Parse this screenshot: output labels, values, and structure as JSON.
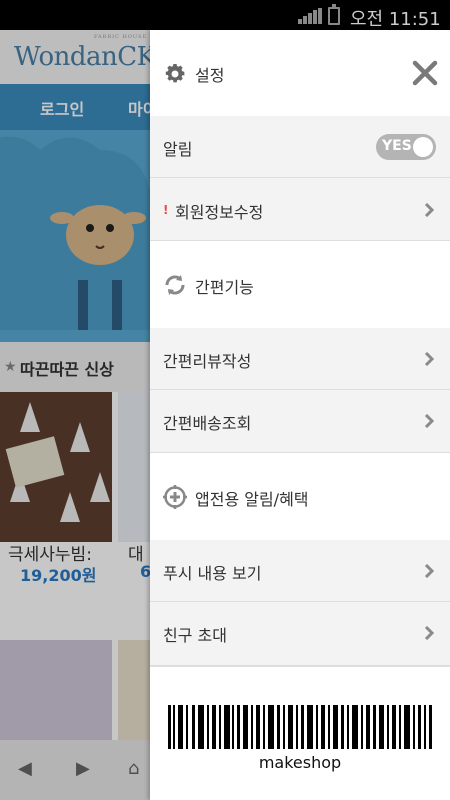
{
  "status_bar": {
    "time": "오전 11:51",
    "signal_icon": "signal-icon",
    "battery_icon": "battery-icon"
  },
  "background_app": {
    "logo": "WondanCK",
    "logo_tagline": "FABRIC HOUSE",
    "nav": [
      "로그인",
      "마이"
    ],
    "section_title": "따끈따끈 신상",
    "products": [
      {
        "name": "극세사누빔:",
        "price": "19,200원"
      },
      {
        "name": "대",
        "price": "6"
      }
    ],
    "bottom_nav": [
      "back-icon",
      "forward-icon",
      "home-icon"
    ]
  },
  "drawer": {
    "header": {
      "icon": "gear-icon",
      "title": "설정",
      "close_icon": "close-icon"
    },
    "notification": {
      "label": "알림",
      "toggle_text": "YES",
      "on": true
    },
    "member_edit": {
      "marker": "!",
      "label": "회원정보수정"
    },
    "quick_section": {
      "icon": "refresh-icon",
      "title": "간편기능",
      "items": [
        {
          "label": "간편리뷰작성"
        },
        {
          "label": "간편배송조회"
        }
      ]
    },
    "app_section": {
      "icon": "crosshair-plus-icon",
      "title": "앱전용 알림/혜택",
      "items": [
        {
          "label": "푸시 내용 보기"
        },
        {
          "label": "친구 초대"
        }
      ]
    },
    "barcode": {
      "text": "makeshop"
    }
  },
  "colors": {
    "nav_blue": "#3a8bbd",
    "banner_blue": "#59a9d2",
    "price_blue": "#2a79c2",
    "toggle_grey": "#b4b4b4",
    "row_grey": "#f3f3f3",
    "alert_red": "#e94b4b"
  }
}
